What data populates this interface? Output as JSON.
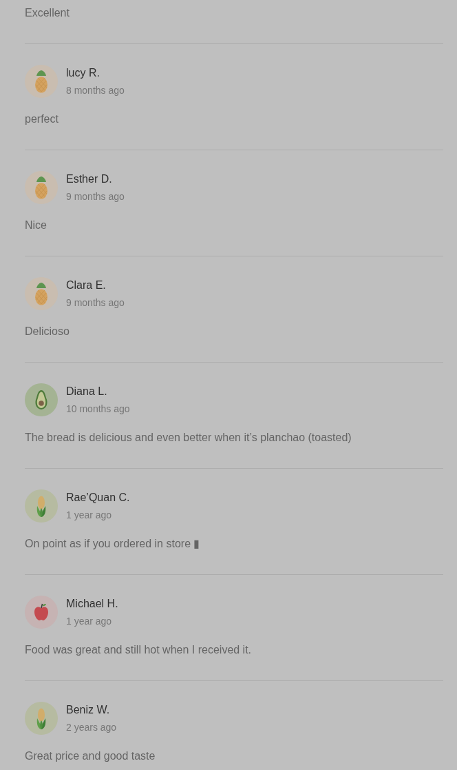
{
  "reviews": [
    {
      "text": "Excellent"
    },
    {
      "name": "lucy R.",
      "time": "8 months ago",
      "avatar": {
        "kind": "pineapple"
      },
      "text": "perfect"
    },
    {
      "name": "Esther D.",
      "time": "9 months ago",
      "avatar": {
        "kind": "pineapple"
      },
      "text": "Nice"
    },
    {
      "name": "Clara E.",
      "time": "9 months ago",
      "avatar": {
        "kind": "pineapple"
      },
      "text": "Delicioso"
    },
    {
      "name": "Diana L.",
      "time": "10 months ago",
      "avatar": {
        "kind": "avocado"
      },
      "text": "The bread is delicious and even better when it’s planchao (toasted)"
    },
    {
      "name": "Rae’Quan C.",
      "time": "1 year ago",
      "avatar": {
        "kind": "corn"
      },
      "text": "On point as if you ordered in store ▮"
    },
    {
      "name": "Michael H.",
      "time": "1 year ago",
      "avatar": {
        "kind": "apple"
      },
      "text": "Food was great and still hot when I received it."
    },
    {
      "name": "Beniz W.",
      "time": "2 years ago",
      "avatar": {
        "kind": "corn"
      },
      "text": "Great price and good taste"
    }
  ]
}
